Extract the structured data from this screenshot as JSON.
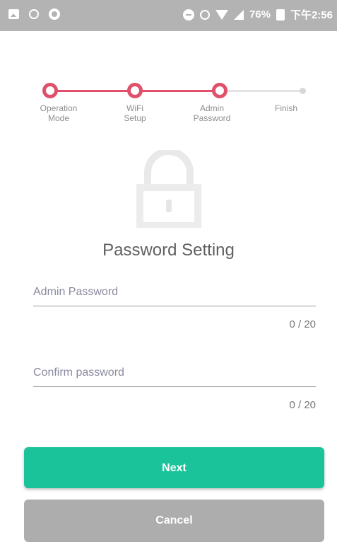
{
  "status_bar": {
    "battery_percent": "76%",
    "time": "下午2:56",
    "left_icons": [
      "image-icon",
      "alarm-icon",
      "record-icon"
    ],
    "right_icons": [
      "dnd-icon",
      "alarm-icon",
      "wifi-icon",
      "signal-icon",
      "battery-icon"
    ]
  },
  "stepper": {
    "steps": [
      {
        "label": "Operation\nMode",
        "state": "done"
      },
      {
        "label": "WiFi\nSetup",
        "state": "done"
      },
      {
        "label": "Admin\nPassword",
        "state": "current"
      },
      {
        "label": "Finish",
        "state": "pending"
      }
    ],
    "active_color": "#e0506b",
    "inactive_color": "#e3e3e3"
  },
  "lock_icon": "lock-icon",
  "title": "Password Setting",
  "fields": {
    "admin_password": {
      "placeholder": "Admin Password",
      "value": "",
      "counter": "0 / 20"
    },
    "confirm_password": {
      "placeholder": "Confirm password",
      "value": "",
      "counter": "0 / 20"
    }
  },
  "buttons": {
    "next": "Next",
    "cancel": "Cancel"
  },
  "colors": {
    "primary": "#1bc39a",
    "secondary": "#adadad",
    "accent": "#e0506b"
  }
}
